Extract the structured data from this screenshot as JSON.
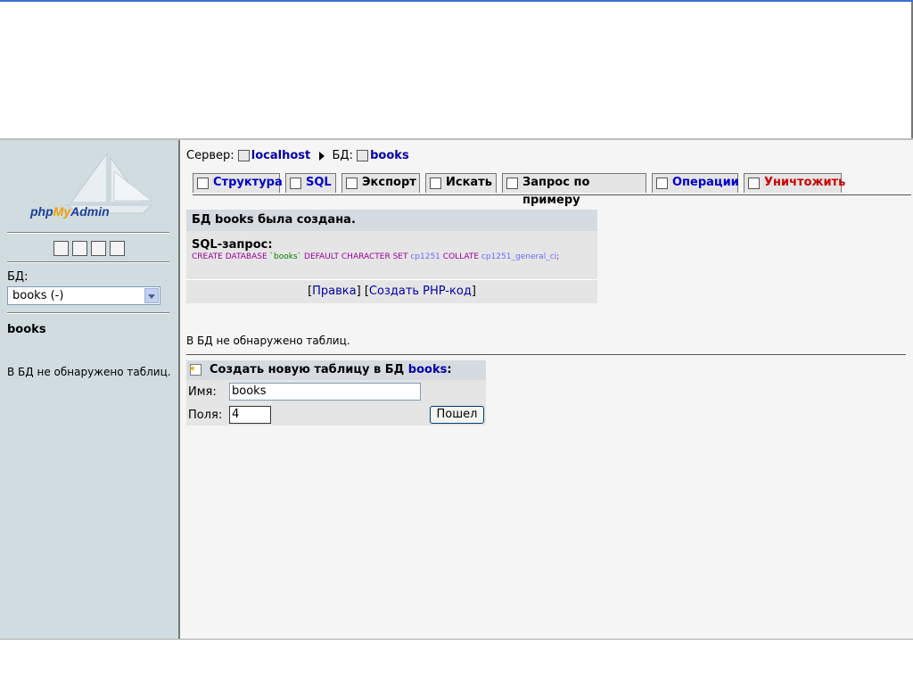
{
  "left": {
    "logo": {
      "part1": "php",
      "part2": "My",
      "part3": "Admin"
    },
    "db_label": "БД:",
    "db_select_value": "books (-)",
    "current_db": "books",
    "no_tables": "В БД не обнаружено таблиц."
  },
  "breadcrumb": {
    "server_label": "Сервер:",
    "server": "localhost",
    "db_label": "БД:",
    "db": "books"
  },
  "tabs": [
    {
      "label": "Структура"
    },
    {
      "label": "SQL"
    },
    {
      "label": "Экспорт"
    },
    {
      "label": "Искать"
    },
    {
      "label": "Запрос по примеру"
    },
    {
      "label": "Операции"
    },
    {
      "label": "Уничтожить"
    }
  ],
  "message": {
    "title": "БД books была создана.",
    "sql_label": "SQL-запрос:",
    "sql": {
      "kw1": "CREATE DATABASE",
      "name": "`books`",
      "kw2": "DEFAULT CHARACTER SET",
      "cs": "cp1251",
      "kw3": "COLLATE",
      "coll": "cp1251_general_ci",
      "end": ";"
    },
    "link_edit": "Правка",
    "link_php": "Создать PHP-код"
  },
  "main_no_tables": "В БД не обнаружено таблиц.",
  "create_table": {
    "title_prefix": "Создать новую таблицу в БД",
    "db": "books",
    "title_suffix": ":",
    "name_label": "Имя:",
    "name_value": "books",
    "fields_label": "Поля:",
    "fields_value": "4",
    "go_button": "Пошел"
  }
}
